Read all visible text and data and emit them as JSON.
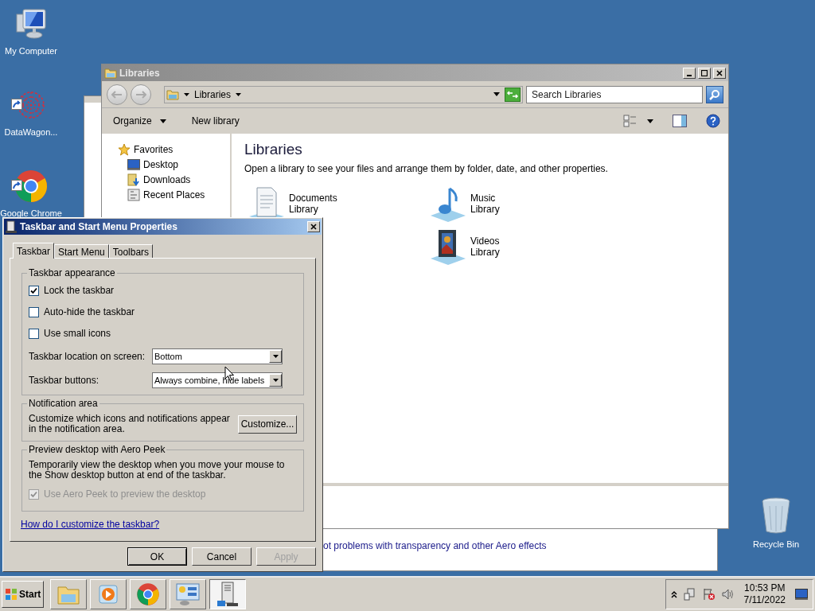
{
  "desktop_icons": [
    {
      "kind": "computer",
      "label": "My Computer"
    },
    {
      "kind": "network-app",
      "label": "DataWagon..."
    },
    {
      "kind": "browser",
      "label": "Google Chrome"
    },
    {
      "kind": "recycle",
      "label": "Recycle Bin"
    }
  ],
  "back_window": {
    "link": "ot problems with transparency and other Aero effects"
  },
  "explorer": {
    "title": "Libraries",
    "breadcrumb": "Libraries",
    "search": {
      "placeholder": "Search Libraries"
    },
    "toolbar": [
      "Organize",
      "New library"
    ],
    "nav": [
      {
        "kind": "star",
        "label": "Favorites",
        "children": [
          {
            "kind": "desktop",
            "label": "Desktop"
          },
          {
            "kind": "downloads",
            "label": "Downloads"
          },
          {
            "kind": "recent",
            "label": "Recent Places"
          }
        ]
      }
    ],
    "heading": "Libraries",
    "description": "Open a library to see your files and arrange them by folder, date, and other properties.",
    "libraries": [
      {
        "kind": "documents",
        "name": "Documents",
        "sub": "Library"
      },
      {
        "kind": "music",
        "name": "Music",
        "sub": "Library"
      },
      {
        "kind": "videos",
        "name": "Videos",
        "sub": "Library"
      }
    ]
  },
  "dialog": {
    "title": "Taskbar and Start Menu Properties",
    "tabs": [
      {
        "label": "Taskbar",
        "selected": true
      },
      {
        "label": "Start Menu",
        "selected": false
      },
      {
        "label": "Toolbars",
        "selected": false
      }
    ],
    "appearance": {
      "legend": "Taskbar appearance",
      "checkboxes": [
        {
          "label": "Lock the taskbar",
          "checked": true,
          "disabled": false
        },
        {
          "label": "Auto-hide the taskbar",
          "checked": false,
          "disabled": false
        },
        {
          "label": "Use small icons",
          "checked": false,
          "disabled": false
        }
      ],
      "selects": [
        {
          "label": "Taskbar location on screen:",
          "value": "Bottom"
        },
        {
          "label": "Taskbar buttons:",
          "value": "Always combine, hide labels"
        }
      ]
    },
    "notification": {
      "legend": "Notification area",
      "text": "Customize which icons and notifications appear in the notification area.",
      "button": "Customize..."
    },
    "peek": {
      "legend": "Preview desktop with Aero Peek",
      "text": "Temporarily view the desktop when you move your mouse to the Show desktop button at end of the taskbar.",
      "checkbox": {
        "label": "Use Aero Peek to preview the desktop",
        "checked": true,
        "disabled": true
      }
    },
    "help_link": "How do I customize the taskbar?",
    "buttons": [
      {
        "label": "OK",
        "disabled": false,
        "default": true
      },
      {
        "label": "Cancel",
        "disabled": false,
        "default": false
      },
      {
        "label": "Apply",
        "disabled": true,
        "default": false
      }
    ]
  },
  "taskbar": {
    "start": "Start",
    "apps": [
      {
        "kind": "folder",
        "selected": false
      },
      {
        "kind": "media",
        "selected": false
      },
      {
        "kind": "browser",
        "selected": false
      },
      {
        "kind": "network",
        "selected": false
      },
      {
        "kind": "server",
        "selected": true
      }
    ],
    "time": "10:53 PM",
    "date": "7/11/2022"
  }
}
